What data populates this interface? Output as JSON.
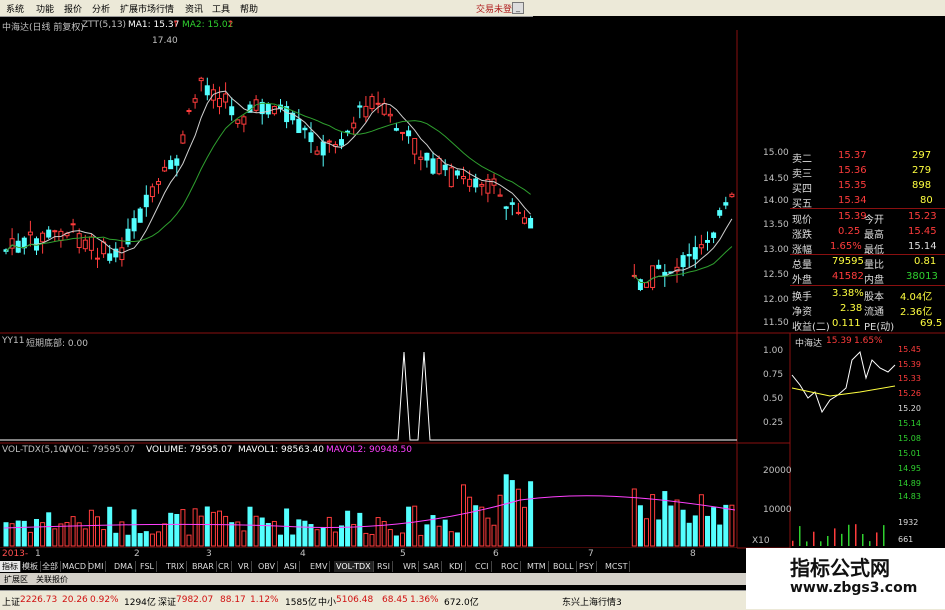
{
  "menu": {
    "items": [
      "系统",
      "功能",
      "报价",
      "分析",
      "扩展市场行情",
      "资讯",
      "工具",
      "帮助"
    ],
    "login": "交易未登录"
  },
  "main_chart": {
    "title": "中海达(日线 前复权)",
    "indicator": "ZTT(5,13)",
    "ma1": "MA1: 15.37",
    "ma2": "MA2: 15.02",
    "high_mark": "17.40",
    "y_ticks": [
      "15.00",
      "14.50",
      "14.00",
      "13.50",
      "13.00",
      "12.50",
      "12.00",
      "11.50"
    ]
  },
  "sub1": {
    "title": "YY11",
    "label": "短期底部: 0.00",
    "y_ticks": [
      "1.00",
      "0.75",
      "0.50",
      "0.25"
    ]
  },
  "sub2": {
    "title": "VOL-TDX(5,10)",
    "vvol": "VVOL: 79595.07",
    "volume": "VOLUME: 79595.07",
    "mavol1": "MAVOL1: 98563.40",
    "mavol2": "MAVOL2: 90948.50",
    "y_ticks": [
      "20000",
      "10000",
      "X10"
    ],
    "date_first": "2013-",
    "months": [
      "1",
      "2",
      "3",
      "4",
      "5",
      "6",
      "7",
      "8"
    ]
  },
  "quote": {
    "rows": [
      {
        "label": "卖二",
        "value": "15.37",
        "vol": "297"
      },
      {
        "label": "卖三",
        "value": "15.36",
        "vol": "279"
      },
      {
        "label": "买四",
        "value": "15.35",
        "vol": "898"
      },
      {
        "label": "买五",
        "value": "15.34",
        "vol": "80"
      }
    ],
    "stats": [
      {
        "l1": "现价",
        "v1": "15.39",
        "l2": "今开",
        "v2": "15.23"
      },
      {
        "l1": "涨跌",
        "v1": "0.25",
        "l2": "最高",
        "v2": "15.45"
      },
      {
        "l1": "涨幅",
        "v1": "1.65%",
        "l2": "最低",
        "v2": "15.14"
      },
      {
        "l1": "总量",
        "v1": "79595",
        "l2": "量比",
        "v2": "0.81"
      },
      {
        "l1": "外盘",
        "v1": "41582",
        "l2": "内盘",
        "v2": "38013"
      },
      {
        "l1": "换手",
        "v1": "3.38%",
        "l2": "股本",
        "v2": "4.04亿"
      },
      {
        "l1": "净资",
        "v1": "2.38",
        "l2": "流通",
        "v2": "2.36亿"
      },
      {
        "l1": "收益(二)",
        "v1": "0.111",
        "l2": "PE(动)",
        "v2": "69.5"
      }
    ],
    "mini_title": "中海达",
    "mini_price": "15.39",
    "mini_pct": "1.65%",
    "mini_ticks": [
      "15.45",
      "15.39",
      "15.33",
      "15.26",
      "15.20",
      "15.14",
      "15.08",
      "15.01",
      "14.95",
      "14.89",
      "14.83",
      "1932",
      "661"
    ]
  },
  "tabs": [
    "指标",
    "模板",
    "全部",
    "MACD",
    "DMI",
    "DMA",
    "FSL",
    "TRIX",
    "BRAR",
    "CR",
    "VR",
    "OBV",
    "ASI",
    "EMV",
    "VOL-TDX",
    "RSI",
    "WR",
    "SAR",
    "KDJ",
    "CCI",
    "ROC",
    "MTM",
    "BOLL",
    "PSY",
    "MCST"
  ],
  "tabs2": [
    "扩展区",
    "关联报价"
  ],
  "status": {
    "sh_label": "上证",
    "sh_val": "2226.73",
    "sh_chg": "20.26",
    "sh_pct": "0.92%",
    "sh_amt": "1294亿",
    "sz_label": "深证",
    "sz_val": "7982.07",
    "sz_chg": "88.17",
    "sz_pct": "1.12%",
    "sz_amt": "1585亿",
    "zx_label": "中小",
    "zx_val": "5106.48",
    "zx_chg": "68.45",
    "zx_pct": "1.36%",
    "zx_amt": "672.0亿",
    "source": "东兴上海行情3"
  },
  "watermark": {
    "line1": "指标公式网",
    "line2": "www.zbgs3.com"
  },
  "colors": {
    "up": "#ff3c3c",
    "down": "#54ffff",
    "ma": "#c0c0c0",
    "ma2": "#1fa01f",
    "grid": "#7a1010",
    "yellow": "#ffff40",
    "magenta": "#ff40ff"
  }
}
